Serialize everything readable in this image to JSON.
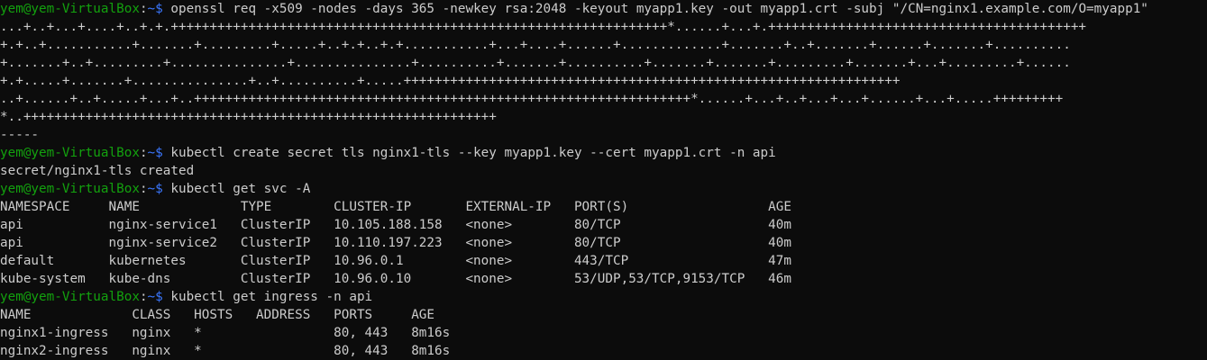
{
  "colors": {
    "background": "#0c0c0c",
    "text": "#cccccc",
    "prompt_user": "#13a10e",
    "prompt_path": "#3b78ff"
  },
  "prompt": {
    "user_host": "yem@yem-VirtualBox",
    "separator": ":",
    "path_symbol": "~$"
  },
  "commands": {
    "openssl": " openssl req -x509 -nodes -days 365 -newkey rsa:2048 -keyout myapp1.key -out myapp1.crt -subj \"/CN=nginx1.example.com/O=myapp1\"",
    "create_secret": " kubectl create secret tls nginx1-tls --key myapp1.key --cert myapp1.crt -n api",
    "get_svc": " kubectl get svc -A",
    "get_ingress": " kubectl get ingress -n api"
  },
  "openssl_output": [
    "...+..+...+....+..+.+.++++++++++++++++++++++++++++++++++++++++++++++++++++++++++++++++*......+...+.+++++++++++++++++++++++++++++++++++++++++",
    "+.+..+...........+.......+.........+.....+..+.+..+.+...........+...+....+......+.............+.......+..+.......+......+.......+..........",
    "+.......+..+.........+...............+...............+..........+.......+..........+.......+.......+.........+.......+...+.........+......",
    "+.+.....+.......+...............+..+..........+.....++++++++++++++++++++++++++++++++++++++++++++++++++++++++++++++++",
    "..+......+..+.....+...+..++++++++++++++++++++++++++++++++++++++++++++++++++++++++++++++++*......+...+..+...+...+......+...+.....+++++++++",
    "*..+++++++++++++++++++++++++++++++++++++++++++++++++++++++++++++",
    "-----"
  ],
  "secret_output": "secret/nginx1-tls created",
  "svc_table": {
    "header": "NAMESPACE     NAME             TYPE        CLUSTER-IP       EXTERNAL-IP   PORT(S)                  AGE",
    "rows": [
      "api           nginx-service1   ClusterIP   10.105.188.158   <none>        80/TCP                   40m",
      "api           nginx-service2   ClusterIP   10.110.197.223   <none>        80/TCP                   40m",
      "default       kubernetes       ClusterIP   10.96.0.1        <none>        443/TCP                  47m",
      "kube-system   kube-dns         ClusterIP   10.96.0.10       <none>        53/UDP,53/TCP,9153/TCP   46m"
    ]
  },
  "ingress_table": {
    "header": "NAME             CLASS   HOSTS   ADDRESS   PORTS     AGE",
    "rows": [
      "nginx1-ingress   nginx   *                 80, 443   8m16s",
      "nginx2-ingress   nginx   *                 80, 443   8m16s"
    ]
  }
}
